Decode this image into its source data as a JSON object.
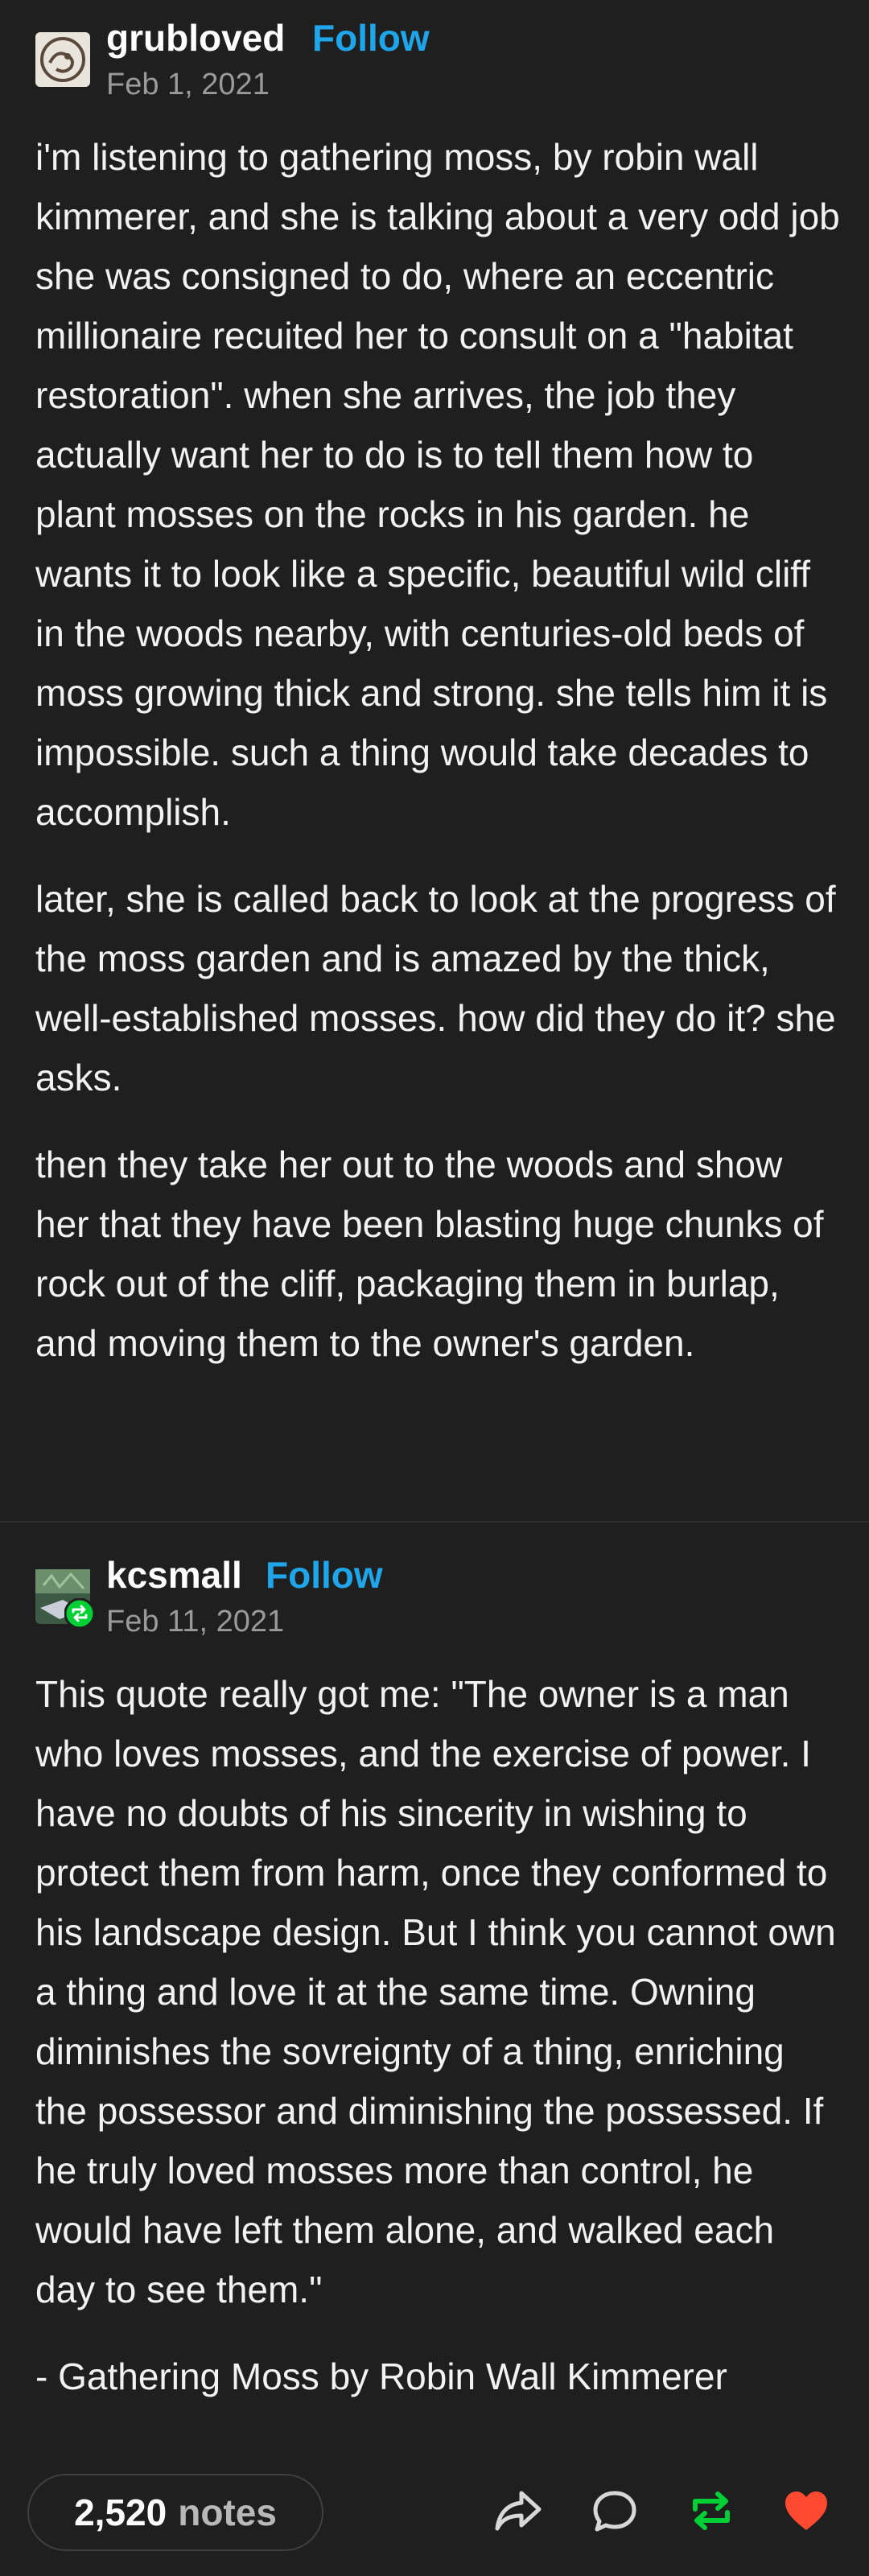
{
  "posts": [
    {
      "username": "grubloved",
      "follow_label": "Follow",
      "date": "Feb 1, 2021",
      "paragraphs": [
        "i'm listening to gathering moss, by robin wall kimmerer, and she is talking about a very odd job she was consigned to do, where an eccentric millionaire recuited her to consult on a \"habitat restoration\". when she arrives, the job they actually want her to do is to tell them how to plant mosses on the rocks in his garden. he wants it to look like a specific, beautiful wild cliff in the woods nearby, with centuries-old beds of moss growing thick and strong.  she tells him it is impossible. such a thing would take decades to accomplish.",
        "later, she is called back to look at the progress of the moss garden and is amazed by the thick, well-established mosses. how did they do it? she asks.",
        "then they take her out to the woods and show her that they have been blasting huge chunks of rock out of the cliff, packaging them in burlap, and moving them to the owner's garden."
      ]
    },
    {
      "username": "kcsmall",
      "follow_label": "Follow",
      "date": "Feb 11, 2021",
      "paragraphs": [
        "This quote really got me: \"The owner is a man who loves mosses, and the exercise of power. I have no doubts of his sincerity in wishing to protect them from harm, once they conformed to his landscape design.  But I think you cannot own a thing and love it at the same time. Owning diminishes the sovreignty of a thing, enriching the possessor and diminishing the possessed. If he truly loved mosses more than control, he would have left them alone, and walked each day to see them.\"",
        "- Gathering Moss by Robin Wall Kimmerer"
      ]
    }
  ],
  "footer": {
    "notes_count": "2,520",
    "notes_label": "notes",
    "icons": [
      "share-icon",
      "reply-icon",
      "reblog-icon",
      "like-icon"
    ]
  },
  "colors": {
    "background": "#1f1f1f",
    "follow": "#1fa6ea",
    "reblog": "#00cf35",
    "like": "#ff4930"
  }
}
